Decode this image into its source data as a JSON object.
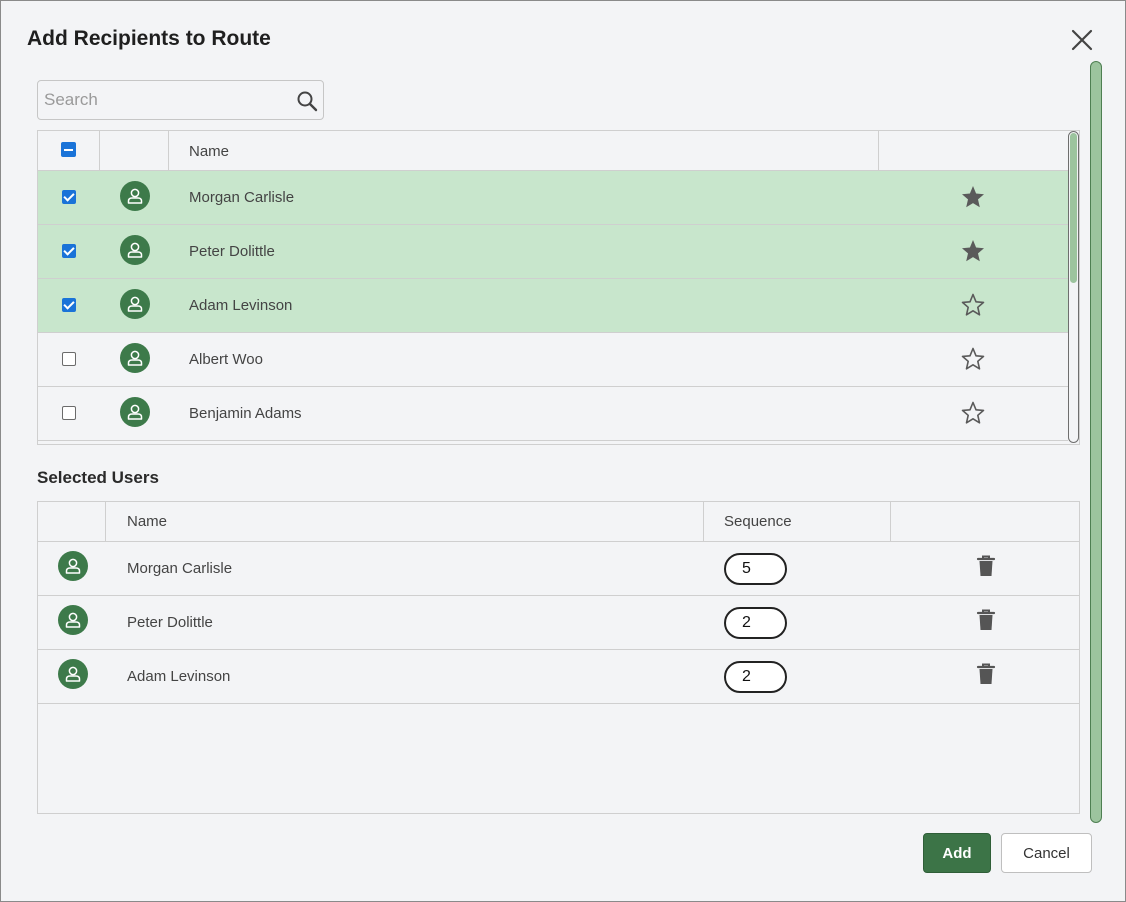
{
  "dialog": {
    "title": "Add Recipients to Route"
  },
  "search": {
    "placeholder": "Search",
    "value": ""
  },
  "recipients_table": {
    "header": {
      "name": "Name"
    },
    "rows": [
      {
        "name": "Morgan Carlisle",
        "checked": true,
        "favorite": true
      },
      {
        "name": "Peter Dolittle",
        "checked": true,
        "favorite": true
      },
      {
        "name": "Adam Levinson",
        "checked": true,
        "favorite": false
      },
      {
        "name": "Albert Woo",
        "checked": false,
        "favorite": false
      },
      {
        "name": "Benjamin Adams",
        "checked": false,
        "favorite": false
      }
    ]
  },
  "selected_users": {
    "title": "Selected Users",
    "headers": {
      "name": "Name",
      "sequence": "Sequence"
    },
    "rows": [
      {
        "name": "Morgan Carlisle",
        "sequence": "5"
      },
      {
        "name": "Peter Dolittle",
        "sequence": "2"
      },
      {
        "name": "Adam Levinson",
        "sequence": "2"
      }
    ]
  },
  "footer": {
    "add_label": "Add",
    "cancel_label": "Cancel"
  },
  "colors": {
    "accent_green": "#3c7447",
    "selected_row": "#c8e6cc",
    "checkbox_blue": "#1a73d8"
  },
  "icons": {
    "close": "close-icon",
    "search": "search-icon",
    "avatar": "user-avatar-icon",
    "favorite_on": "star-filled-icon",
    "favorite_off": "star-outline-icon",
    "delete": "trash-icon"
  }
}
